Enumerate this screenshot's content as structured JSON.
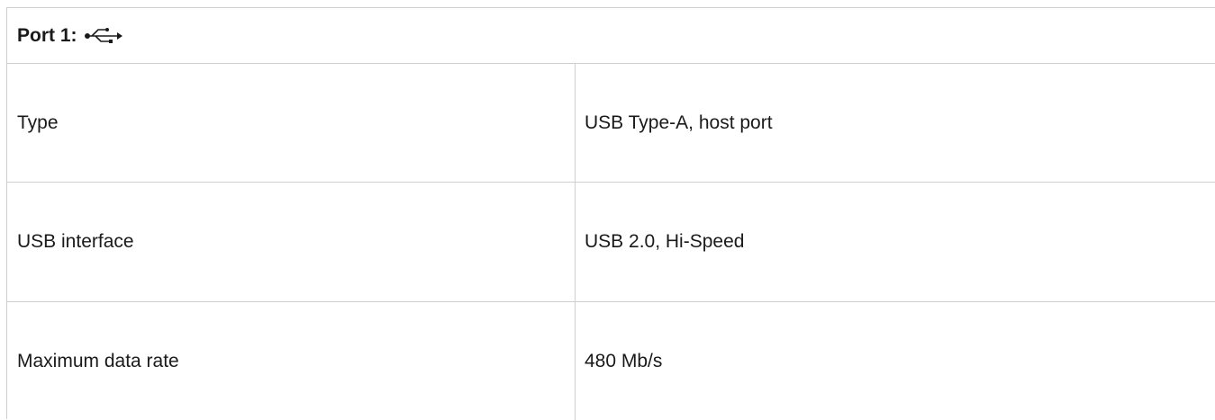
{
  "port": {
    "title": "Port 1:",
    "icon": "usb-icon"
  },
  "rows": [
    {
      "label": "Type",
      "value": "USB Type-A, host port"
    },
    {
      "label": "USB interface",
      "value": "USB 2.0, Hi-Speed"
    },
    {
      "label": "Maximum data rate",
      "value": "480 Mb/s"
    }
  ]
}
